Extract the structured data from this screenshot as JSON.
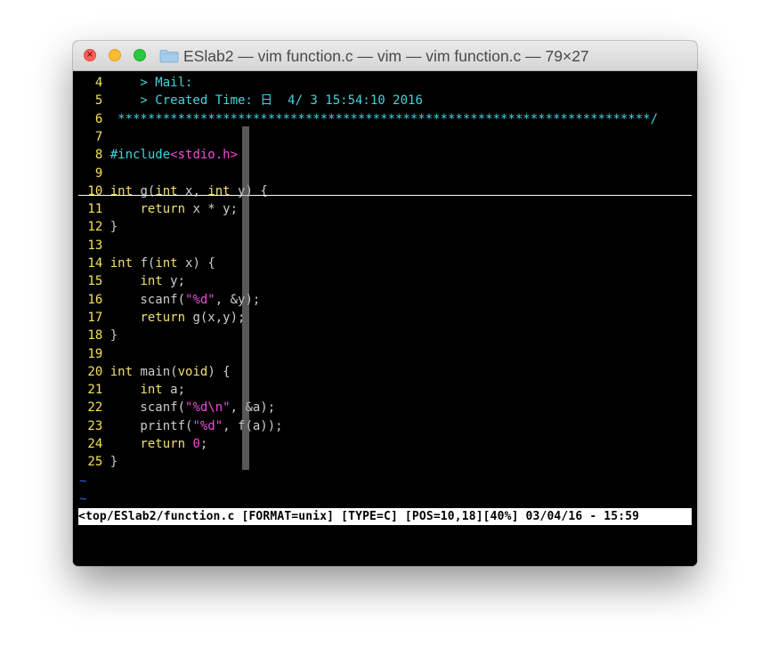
{
  "window": {
    "title": "ESlab2 — vim function.c — vim — vim function.c — 79×27",
    "close_symbol": "×"
  },
  "colors": {
    "line_number": "#f5e35a",
    "keyword": "#f0e070",
    "comment": "#42d4e0",
    "string": "#ee4ed8",
    "tilde": "#3a64f0",
    "status_bg": "#ffffff"
  },
  "editor": {
    "lines": [
      {
        "number": "4",
        "segments": [
          {
            "text": "    > Mail:",
            "style": "cyan"
          }
        ]
      },
      {
        "number": "5",
        "segments": [
          {
            "text": "    > Created Time: 日  4/ 3 15:54:10 2016",
            "style": "cyan"
          }
        ]
      },
      {
        "number": "6",
        "segments": [
          {
            "text": " ***********************************************************************/",
            "style": "cyan"
          }
        ]
      },
      {
        "number": "7",
        "segments": []
      },
      {
        "number": "8",
        "segments": [
          {
            "text": "#include",
            "style": "cyan"
          },
          {
            "text": "<stdio.h>",
            "style": "mag"
          }
        ]
      },
      {
        "number": "9",
        "segments": []
      },
      {
        "number": "10",
        "segments": [
          {
            "text": "int",
            "style": "kw"
          },
          {
            "text": " g(",
            "style": ""
          },
          {
            "text": "int",
            "style": "kw"
          },
          {
            "text": " x, ",
            "style": ""
          },
          {
            "text": "int",
            "style": "kw"
          },
          {
            "text": " y) {",
            "style": ""
          }
        ]
      },
      {
        "number": "11",
        "segments": [
          {
            "text": "    ",
            "style": ""
          },
          {
            "text": "return",
            "style": "kw"
          },
          {
            "text": " x * y;",
            "style": ""
          }
        ]
      },
      {
        "number": "12",
        "segments": [
          {
            "text": "}",
            "style": ""
          }
        ]
      },
      {
        "number": "13",
        "segments": []
      },
      {
        "number": "14",
        "segments": [
          {
            "text": "int",
            "style": "kw"
          },
          {
            "text": " f(",
            "style": ""
          },
          {
            "text": "int",
            "style": "kw"
          },
          {
            "text": " x) {",
            "style": ""
          }
        ]
      },
      {
        "number": "15",
        "segments": [
          {
            "text": "    ",
            "style": ""
          },
          {
            "text": "int",
            "style": "kw"
          },
          {
            "text": " y;",
            "style": ""
          }
        ]
      },
      {
        "number": "16",
        "segments": [
          {
            "text": "    scanf(",
            "style": ""
          },
          {
            "text": "\"%d\"",
            "style": "mag"
          },
          {
            "text": ", &y);",
            "style": ""
          }
        ]
      },
      {
        "number": "17",
        "segments": [
          {
            "text": "    ",
            "style": ""
          },
          {
            "text": "return",
            "style": "kw"
          },
          {
            "text": " g(x,y);",
            "style": ""
          }
        ]
      },
      {
        "number": "18",
        "segments": [
          {
            "text": "}",
            "style": ""
          }
        ]
      },
      {
        "number": "19",
        "segments": []
      },
      {
        "number": "20",
        "segments": [
          {
            "text": "int",
            "style": "kw"
          },
          {
            "text": " main(",
            "style": ""
          },
          {
            "text": "void",
            "style": "kw"
          },
          {
            "text": ") {",
            "style": ""
          }
        ]
      },
      {
        "number": "21",
        "segments": [
          {
            "text": "    ",
            "style": ""
          },
          {
            "text": "int",
            "style": "kw"
          },
          {
            "text": " a;",
            "style": ""
          }
        ]
      },
      {
        "number": "22",
        "segments": [
          {
            "text": "    scanf(",
            "style": ""
          },
          {
            "text": "\"%d\\n\"",
            "style": "mag"
          },
          {
            "text": ", &a);",
            "style": ""
          }
        ]
      },
      {
        "number": "23",
        "segments": [
          {
            "text": "    printf(",
            "style": ""
          },
          {
            "text": "\"%d\"",
            "style": "mag"
          },
          {
            "text": ", f(a));",
            "style": ""
          }
        ]
      },
      {
        "number": "24",
        "segments": [
          {
            "text": "    ",
            "style": ""
          },
          {
            "text": "return",
            "style": "kw"
          },
          {
            "text": " ",
            "style": ""
          },
          {
            "text": "0",
            "style": "mag"
          },
          {
            "text": ";",
            "style": ""
          }
        ]
      },
      {
        "number": "25",
        "segments": [
          {
            "text": "}",
            "style": ""
          }
        ]
      }
    ],
    "empty_markers": [
      "~",
      "~"
    ]
  },
  "status_line": {
    "text": "<top/ESlab2/function.c [FORMAT=unix] [TYPE=C] [POS=10,18][40%] 03/04/16 - 15:59"
  }
}
